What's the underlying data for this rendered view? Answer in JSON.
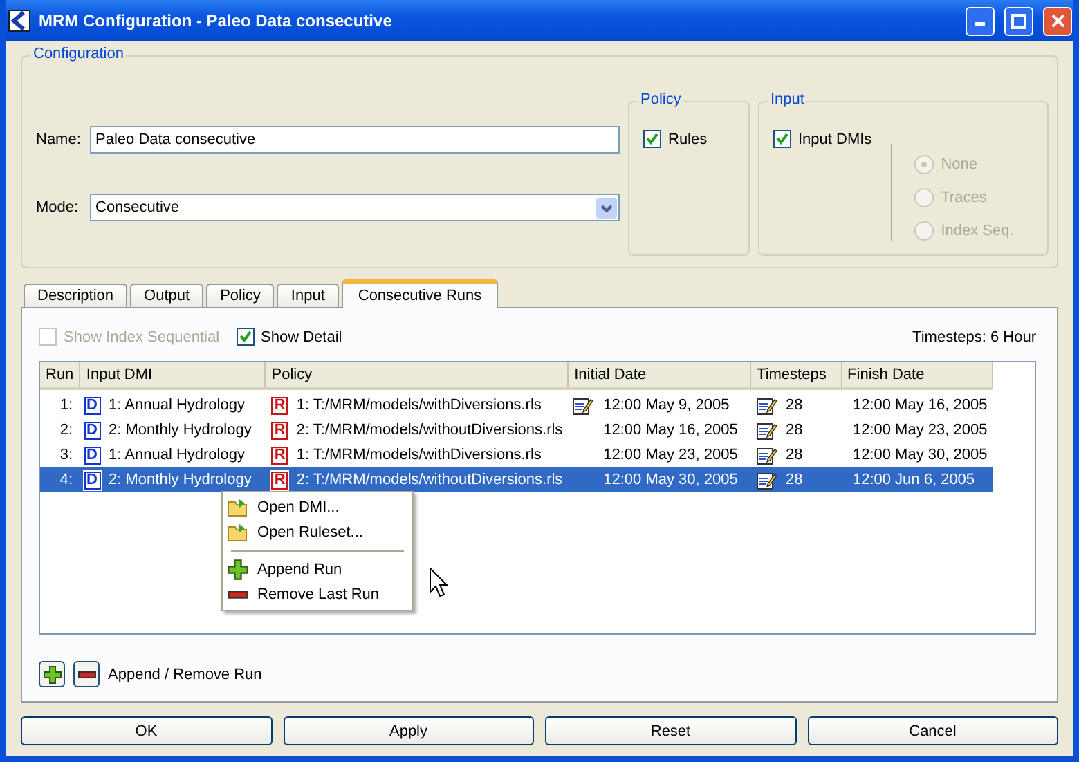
{
  "window": {
    "title": "MRM Configuration - Paleo Data consecutive"
  },
  "configuration": {
    "title": "Configuration",
    "name_label": "Name:",
    "name_value": "Paleo Data consecutive",
    "mode_label": "Mode:",
    "mode_value": "Consecutive"
  },
  "policy": {
    "title": "Policy",
    "rules": {
      "label": "Rules",
      "checked": true
    }
  },
  "input": {
    "title": "Input",
    "input_dmis": {
      "label": "Input DMIs",
      "checked": true
    },
    "options": [
      {
        "label": "None",
        "selected": true,
        "disabled": true
      },
      {
        "label": "Traces",
        "selected": false,
        "disabled": true
      },
      {
        "label": "Index Seq.",
        "selected": false,
        "disabled": true
      }
    ]
  },
  "tabs": [
    {
      "label": "Description",
      "selected": false
    },
    {
      "label": "Output",
      "selected": false
    },
    {
      "label": "Policy",
      "selected": false
    },
    {
      "label": "Input",
      "selected": false
    },
    {
      "label": "Consecutive Runs",
      "selected": true
    }
  ],
  "options": [
    {
      "label": "Show Index Sequential",
      "checked": false,
      "disabled": true
    },
    {
      "label": "Show Detail",
      "checked": true,
      "disabled": false
    }
  ],
  "timesteps_label": "Timesteps: 6 Hour",
  "table": {
    "columns": [
      "Run",
      "Input DMI",
      "Policy",
      "Initial Date",
      "Timesteps",
      "Finish Date"
    ],
    "rows": [
      {
        "run": "1:",
        "dmi_badge": "D",
        "input_dmi": "1: Annual Hydrology",
        "policy_badge": "R",
        "policy": "1: T:/MRM/models/withDiversions.rls",
        "initial_date_editable": true,
        "initial_date": "12:00 May 9, 2005",
        "timesteps": "28",
        "finish_date": "12:00 May 16, 2005",
        "selected": false
      },
      {
        "run": "2:",
        "dmi_badge": "D",
        "input_dmi": "2: Monthly Hydrology",
        "policy_badge": "R",
        "policy": "2: T:/MRM/models/withoutDiversions.rls",
        "initial_date_editable": false,
        "initial_date": "12:00 May 16, 2005",
        "timesteps": "28",
        "finish_date": "12:00 May 23, 2005",
        "selected": false
      },
      {
        "run": "3:",
        "dmi_badge": "D",
        "input_dmi": "1: Annual Hydrology",
        "policy_badge": "R",
        "policy": "1: T:/MRM/models/withDiversions.rls",
        "initial_date_editable": false,
        "initial_date": "12:00 May 23, 2005",
        "timesteps": "28",
        "finish_date": "12:00 May 30, 2005",
        "selected": false
      },
      {
        "run": "4:",
        "dmi_badge": "D",
        "input_dmi": "2: Monthly Hydrology",
        "policy_badge": "R",
        "policy": "2: T:/MRM/models/withoutDiversions.rls",
        "initial_date_editable": false,
        "initial_date": "12:00 May 30, 2005",
        "timesteps": "28",
        "finish_date": "12:00 Jun 6, 2005",
        "selected": true
      }
    ]
  },
  "context_menu": [
    {
      "kind": "folder",
      "label": "Open DMI..."
    },
    {
      "kind": "folder",
      "label": "Open Ruleset..."
    },
    {
      "kind": "separator"
    },
    {
      "kind": "add",
      "label": "Append Run"
    },
    {
      "kind": "remove",
      "label": "Remove Last Run"
    }
  ],
  "append_remove_label": "Append / Remove Run",
  "buttons": [
    "OK",
    "Apply",
    "Reset",
    "Cancel"
  ]
}
